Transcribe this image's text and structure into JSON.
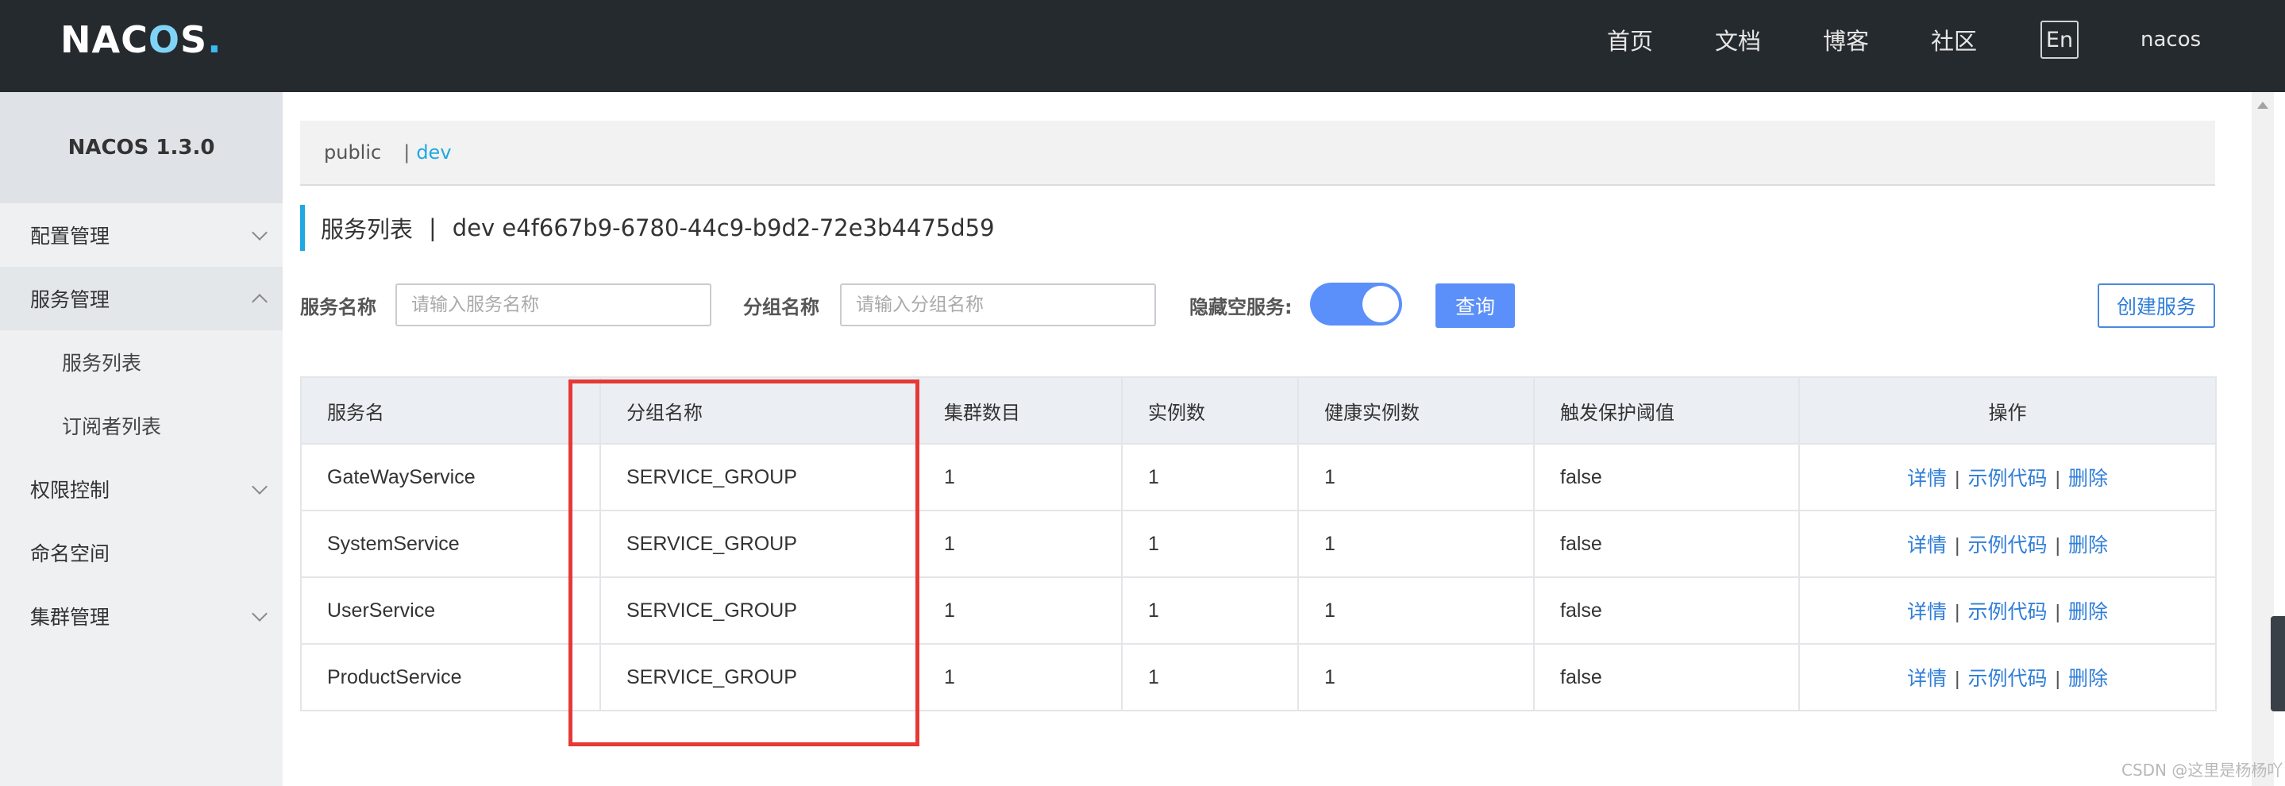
{
  "header": {
    "logo": {
      "n": "N",
      "a": "A",
      "c": "C",
      "o": "O",
      "s": "S",
      "dot": "."
    },
    "nav": {
      "home": "首页",
      "docs": "文档",
      "blog": "博客",
      "community": "社区",
      "lang": "En",
      "user": "nacos"
    }
  },
  "sidebar": {
    "title": "NACOS 1.3.0",
    "items": [
      {
        "label": "配置管理"
      },
      {
        "label": "服务管理"
      },
      {
        "label": "服务列表"
      },
      {
        "label": "订阅者列表"
      },
      {
        "label": "权限控制"
      },
      {
        "label": "命名空间"
      },
      {
        "label": "集群管理"
      }
    ]
  },
  "namespace_bar": {
    "public": "public",
    "separator": "|",
    "dev": "dev"
  },
  "page_title": {
    "title": "服务列表",
    "separator": "|",
    "namespace": "dev  e4f667b9-6780-44c9-b9d2-72e3b4475d59"
  },
  "filters": {
    "service_label": "服务名称",
    "service_placeholder": "请输入服务名称",
    "group_label": "分组名称",
    "group_placeholder": "请输入分组名称",
    "hide_empty_label": "隐藏空服务:",
    "hide_empty_enabled": true,
    "query_button": "查询",
    "create_button": "创建服务"
  },
  "table": {
    "headers": [
      "服务名",
      "",
      "分组名称",
      "集群数目",
      "实例数",
      "健康实例数",
      "触发保护阈值",
      "操作"
    ],
    "rows": [
      [
        "GateWayService",
        "",
        "SERVICE_GROUP",
        "1",
        "1",
        "1",
        "false"
      ],
      [
        "SystemService",
        "",
        "SERVICE_GROUP",
        "1",
        "1",
        "1",
        "false"
      ],
      [
        "UserService",
        "",
        "SERVICE_GROUP",
        "1",
        "1",
        "1",
        "false"
      ],
      [
        "ProductService",
        "",
        "SERVICE_GROUP",
        "1",
        "1",
        "1",
        "false"
      ]
    ],
    "ops": {
      "detail": "详情",
      "sample_code": "示例代码",
      "delete": "删除",
      "separator": "|"
    }
  },
  "accent_colors": {
    "primary": "#5b8ff9",
    "link": "#2f7ed8",
    "highlight_box": "#e53935",
    "active_namespace": "#20a8e0"
  },
  "watermark": "CSDN @这里是杨杨吖"
}
